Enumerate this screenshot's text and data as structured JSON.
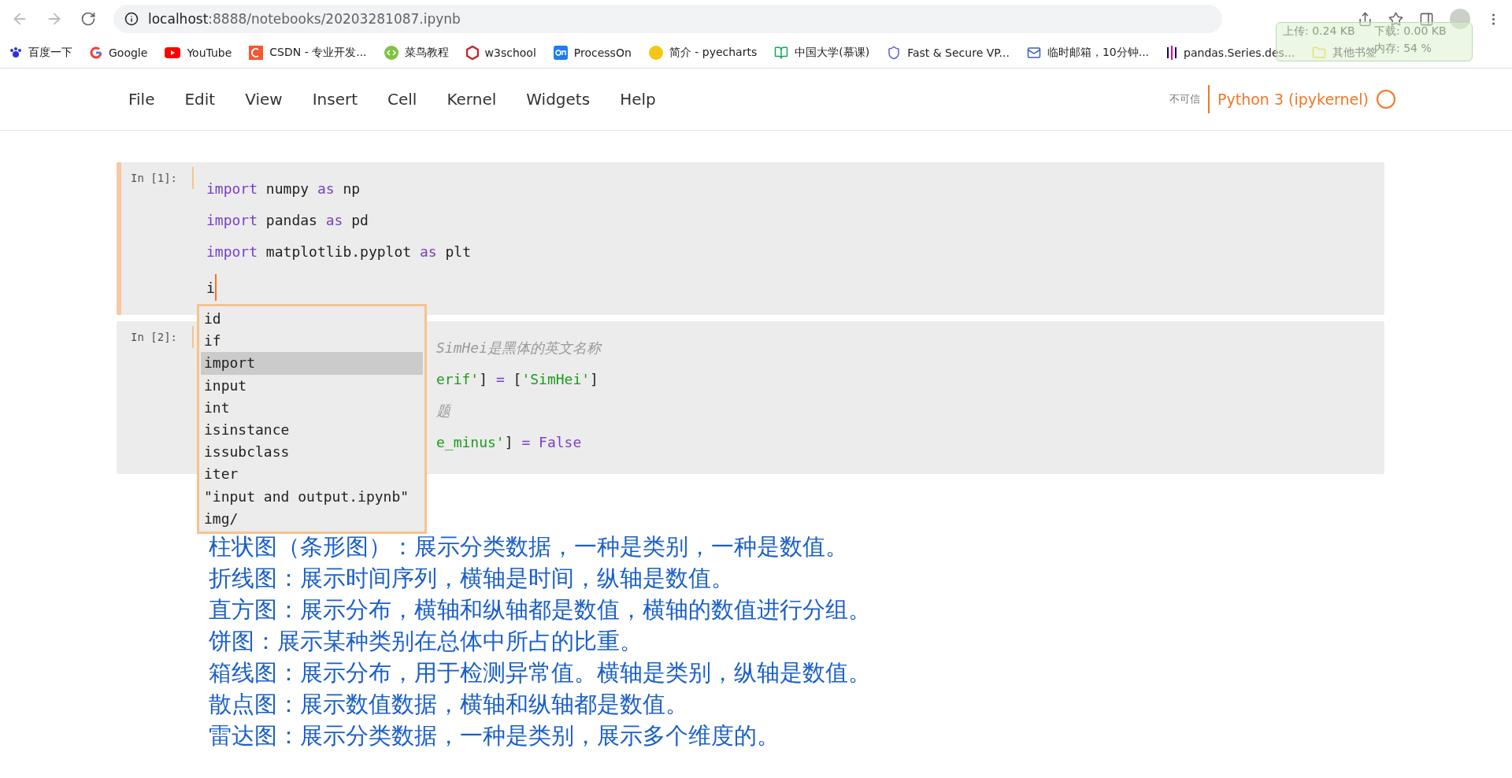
{
  "browser": {
    "url_host": "localhost",
    "url_rest": ":8888/notebooks/20203281087.ipynb"
  },
  "bookmarks": [
    "百度一下",
    "Google",
    "YouTube",
    "CSDN - 专业开发...",
    "菜鸟教程",
    "w3school",
    "ProcessOn",
    "简介 - pyecharts",
    "中国大学(慕课)",
    "Fast & Secure VP...",
    "临时邮箱，10分钟...",
    "pandas.Series.des...",
    "其他书签"
  ],
  "net_widget": {
    "upload": "上传: 0.24 KB",
    "download": "下载: 0.00 KB",
    "memory": "内存: 54 %"
  },
  "menu": [
    "File",
    "Edit",
    "View",
    "Insert",
    "Cell",
    "Kernel",
    "Widgets",
    "Help"
  ],
  "trust": "不可信",
  "kernel": {
    "name": "Python 3 (ipykernel)",
    "busy": false
  },
  "cells": [
    {
      "prompt": "In [1]:",
      "selected": true,
      "lines": [
        [
          {
            "kind": "kw",
            "text": "import"
          },
          {
            "kind": "plain",
            "text": " numpy "
          },
          {
            "kind": "kw",
            "text": "as"
          },
          {
            "kind": "plain",
            "text": " np"
          }
        ],
        [
          {
            "kind": "kw",
            "text": "import"
          },
          {
            "kind": "plain",
            "text": " pandas "
          },
          {
            "kind": "kw",
            "text": "as"
          },
          {
            "kind": "plain",
            "text": " pd"
          }
        ],
        [
          {
            "kind": "kw",
            "text": "import"
          },
          {
            "kind": "plain",
            "text": " matplotlib.pyplot "
          },
          {
            "kind": "kw",
            "text": "as"
          },
          {
            "kind": "plain",
            "text": " plt"
          }
        ],
        [
          {
            "kind": "plain",
            "text": "i"
          }
        ]
      ]
    },
    {
      "prompt": "In [2]:",
      "selected": false,
      "lines": [
        [
          {
            "kind": "comment",
            "text": "SimHei是黑体的英文名称"
          }
        ],
        [
          {
            "kind": "str",
            "text": "erif'"
          },
          {
            "kind": "plain",
            "text": "] "
          },
          {
            "kind": "op",
            "text": "="
          },
          {
            "kind": "plain",
            "text": " ["
          },
          {
            "kind": "str",
            "text": "'SimHei'"
          },
          {
            "kind": "plain",
            "text": "]"
          }
        ],
        [
          {
            "kind": "comment",
            "text": "题"
          }
        ],
        [
          {
            "kind": "str",
            "text": "e_minus'"
          },
          {
            "kind": "plain",
            "text": "] "
          },
          {
            "kind": "op",
            "text": "="
          },
          {
            "kind": "kw",
            "text": " False"
          }
        ]
      ]
    }
  ],
  "completions": [
    {
      "text": "id",
      "selected": false
    },
    {
      "text": "if",
      "selected": false
    },
    {
      "text": "import",
      "selected": true
    },
    {
      "text": "input",
      "selected": false
    },
    {
      "text": "int",
      "selected": false
    },
    {
      "text": "isinstance",
      "selected": false
    },
    {
      "text": "issubclass",
      "selected": false
    },
    {
      "text": "iter",
      "selected": false
    },
    {
      "text": "\"input and output.ipynb\"",
      "selected": false
    },
    {
      "text": "img/",
      "selected": false
    }
  ],
  "markdown": [
    "柱状图（条形图）：展示分类数据，一种是类别，一种是数值。",
    "折线图：展示时间序列，横轴是时间，纵轴是数值。",
    "直方图：展示分布，横轴和纵轴都是数值，横轴的数值进行分组。",
    "饼图：展示某种类别在总体中所占的比重。",
    "箱线图：展示分布，用于检测异常值。横轴是类别，纵轴是数值。",
    "散点图：展示数值数据，横轴和纵轴都是数值。",
    "雷达图：展示分类数据，一种是类别，展示多个维度的。"
  ]
}
